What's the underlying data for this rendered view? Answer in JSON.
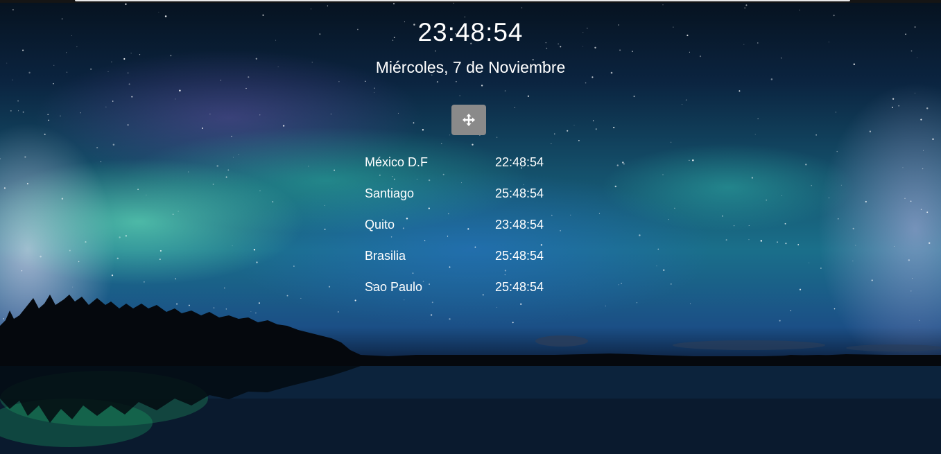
{
  "clock": {
    "time": "23:48:54"
  },
  "date": {
    "text": "Miércoles, 7 de Noviembre"
  },
  "move_button": {
    "icon": "move-arrows-icon"
  },
  "timezones": [
    {
      "city": "México D.F",
      "time": "22:48:54"
    },
    {
      "city": "Santiago",
      "time": "25:48:54"
    },
    {
      "city": "Quito",
      "time": "23:48:54"
    },
    {
      "city": "Brasilia",
      "time": "25:48:54"
    },
    {
      "city": "Sao Paulo",
      "time": "25:48:54"
    }
  ],
  "colors": {
    "text": "#ffffff",
    "button_bg": "#8a8a8a"
  }
}
